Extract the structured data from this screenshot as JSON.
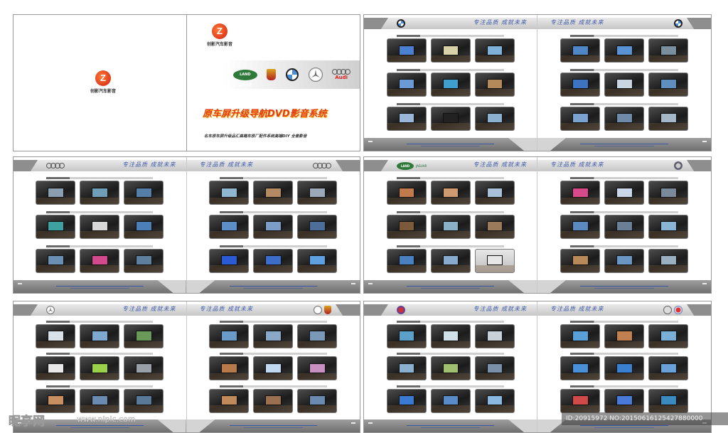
{
  "cover": {
    "company_name": "创影汽车影音",
    "title": "原车屏升级导航DVD影音系统",
    "subtitle": "名车原车屏升级品汇高端车原厂配件系统高端DIY 全套影音",
    "brands": [
      "LAND ROVER",
      "Porsche",
      "BMW",
      "Mercedes-Benz",
      "Audi"
    ],
    "audi_text": "Audi",
    "land_rover_text": "LAND ROVER"
  },
  "slogan": "专注品质 成就未来",
  "spreads": [
    {
      "id": "bmw",
      "left_brand": "bmw-logo",
      "right_brand": "bmw-logo"
    },
    {
      "id": "audi",
      "left_brand": "audi-logo",
      "right_brand": "audi-logo"
    },
    {
      "id": "landrover-volvo",
      "left_brand": "land-rover-jaguar-logo",
      "right_brand": "volvo-logo"
    },
    {
      "id": "mercedes-porsche",
      "left_brand": "mercedes-logo",
      "right_brand": "porsche-logo"
    },
    {
      "id": "cadillac-others",
      "left_brand": "cadillac-logo",
      "right_brand": "misc-brand-logos"
    }
  ],
  "watermark": {
    "text": "昵享网",
    "url": "www.nipic.com",
    "id_line": "ID:20915972 NO:20150616125427880000"
  },
  "colors": {
    "accent_blue": "#3b58a8",
    "title_red": "#e43c12",
    "header_gray": "#c7c7c7",
    "footer_gray": "#7a7a7a"
  }
}
